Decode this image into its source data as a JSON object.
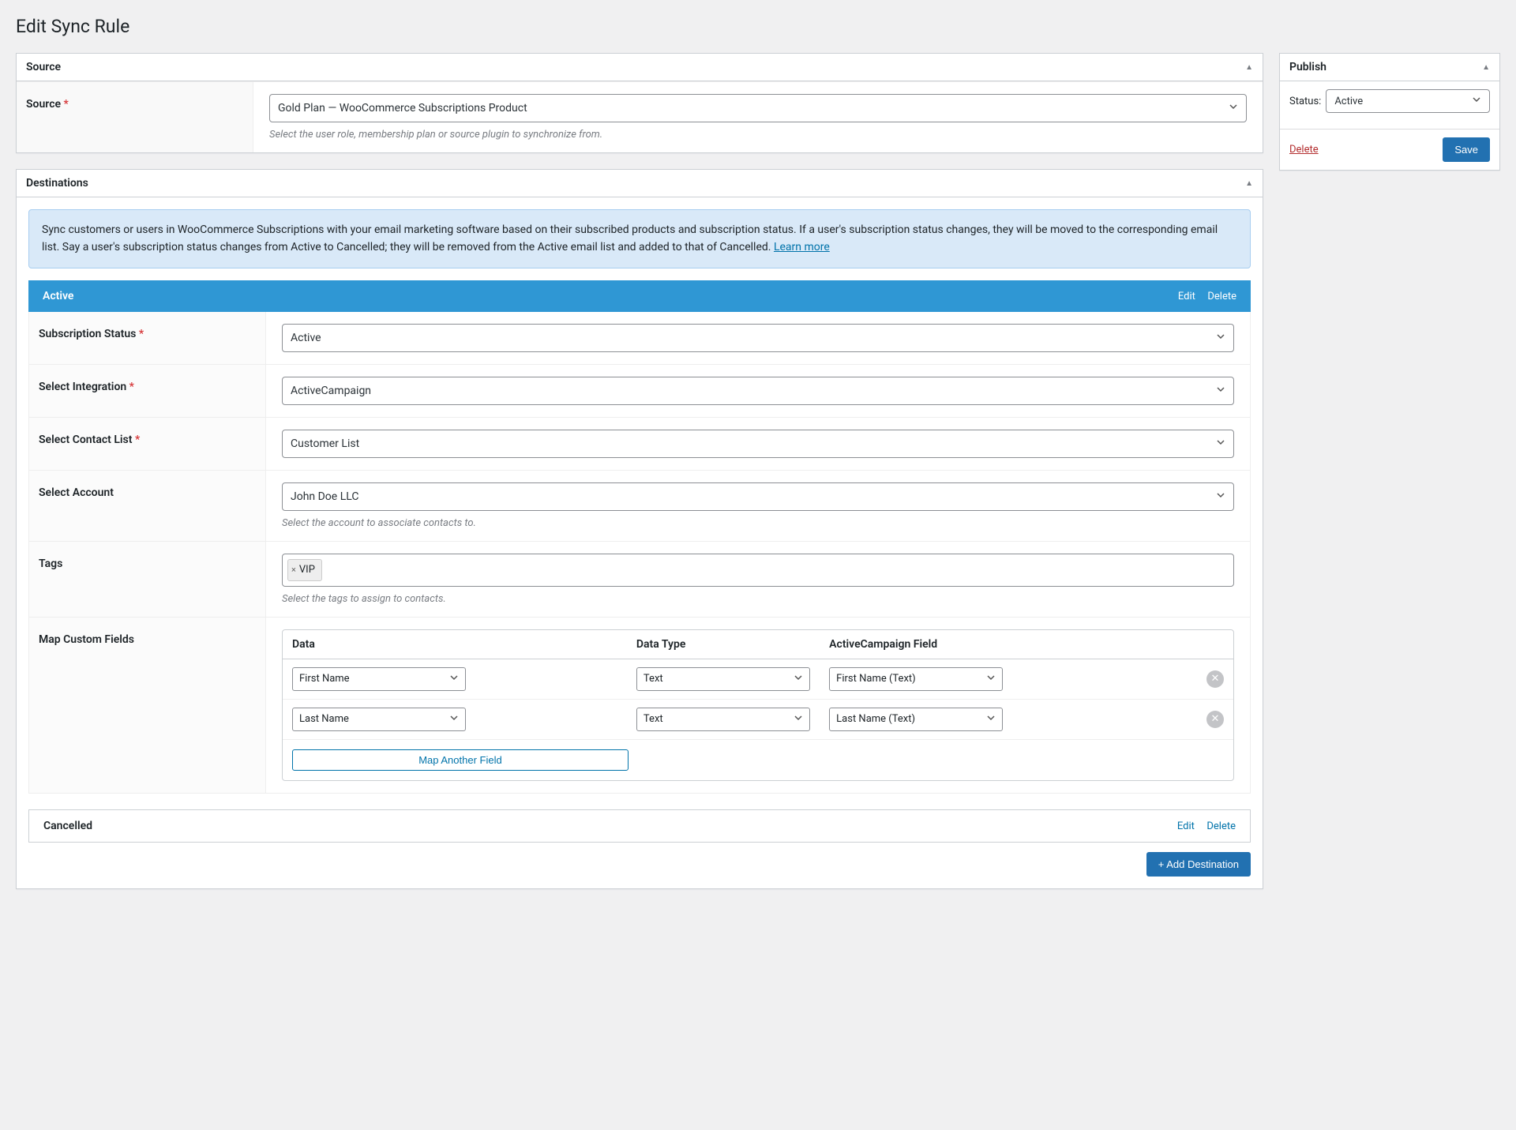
{
  "page_title": "Edit Sync Rule",
  "source": {
    "heading": "Source",
    "label": "Source",
    "required_mark": "*",
    "value": "Gold Plan — WooCommerce Subscriptions Product",
    "help": "Select the user role, membership plan or source plugin to synchronize from."
  },
  "destinations": {
    "heading": "Destinations",
    "info": "Sync customers or users in WooCommerce Subscriptions with your email marketing software based on their subscribed products and subscription status. If a user's subscription status changes, they will be moved to the corresponding email list. Say a user's subscription status changes from Active to Cancelled; they will be removed from the Active email list and added to that of Cancelled. ",
    "learn_more": "Learn more",
    "active_title": "Active",
    "edit": "Edit",
    "delete": "Delete",
    "fields": {
      "status_label": "Subscription Status",
      "status_value": "Active",
      "integration_label": "Select Integration",
      "integration_value": "ActiveCampaign",
      "list_label": "Select Contact List",
      "list_value": "Customer List",
      "account_label": "Select Account",
      "account_value": "John Doe LLC",
      "account_help": "Select the account to associate contacts to.",
      "tags_label": "Tags",
      "tags_value": "VIP",
      "tags_help": "Select the tags to assign to contacts.",
      "map_label": "Map Custom Fields"
    },
    "cf_headers": {
      "data": "Data",
      "type": "Data Type",
      "field": "ActiveCampaign Field"
    },
    "cf_rows": [
      {
        "data": "First Name",
        "type": "Text",
        "field": "First Name (Text)"
      },
      {
        "data": "Last Name",
        "type": "Text",
        "field": "Last Name (Text)"
      }
    ],
    "map_another": "Map Another Field",
    "cancelled_title": "Cancelled",
    "add_destination": "+ Add Destination"
  },
  "publish": {
    "heading": "Publish",
    "status_label": "Status:",
    "status_value": "Active",
    "delete": "Delete",
    "save": "Save"
  },
  "required_mark": "*"
}
